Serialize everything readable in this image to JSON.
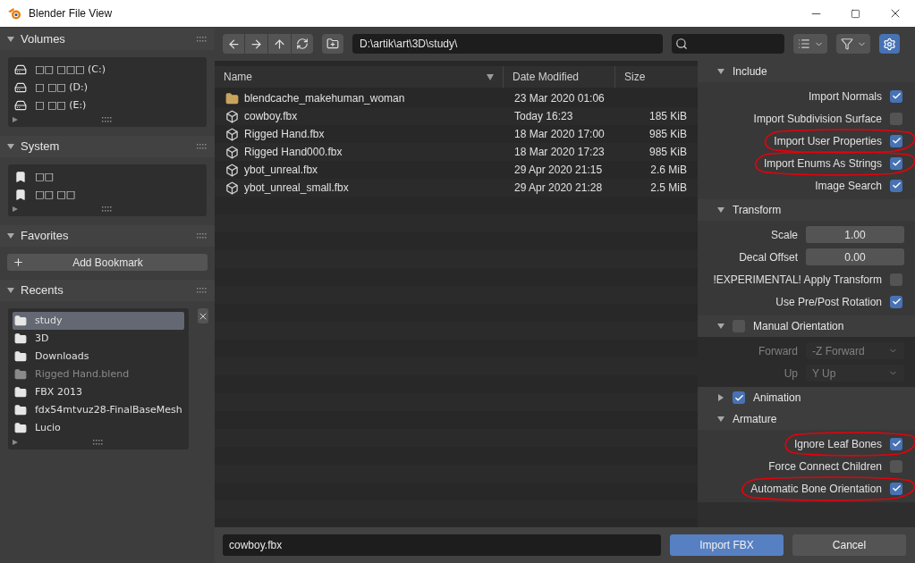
{
  "window": {
    "title": "Blender File View"
  },
  "sidebar": {
    "sections": [
      {
        "title": "Volumes",
        "expanded": true,
        "kind": "list",
        "items": [
          {
            "label": "□□ □□□ (C:)",
            "kind": "drive",
            "selected": false,
            "disabled": false
          },
          {
            "label": "□ □□ (D:)",
            "kind": "drive",
            "selected": false,
            "disabled": false
          },
          {
            "label": "□ □□ (E:)",
            "kind": "drive",
            "selected": false,
            "disabled": false
          }
        ]
      },
      {
        "title": "System",
        "expanded": true,
        "kind": "list",
        "items": [
          {
            "label": "□□",
            "kind": "bookmark",
            "selected": false,
            "disabled": false
          },
          {
            "label": "□□ □□",
            "kind": "bookmark",
            "selected": false,
            "disabled": false
          }
        ]
      },
      {
        "title": "Favorites",
        "expanded": true,
        "kind": "button",
        "button": "Add Bookmark"
      },
      {
        "title": "Recents",
        "expanded": true,
        "kind": "list",
        "clearable": true,
        "items": [
          {
            "label": "study",
            "kind": "folder",
            "selected": true,
            "disabled": false
          },
          {
            "label": "3D",
            "kind": "folder",
            "selected": false,
            "disabled": false
          },
          {
            "label": "Downloads",
            "kind": "folder",
            "selected": false,
            "disabled": false
          },
          {
            "label": "Rigged Hand.blend",
            "kind": "folder",
            "selected": false,
            "disabled": true
          },
          {
            "label": "FBX 2013",
            "kind": "folder",
            "selected": false,
            "disabled": false
          },
          {
            "label": "fdx54mtvuz28-FinalBaseMesh",
            "kind": "folder",
            "selected": false,
            "disabled": false
          },
          {
            "label": "Lucio",
            "kind": "folder",
            "selected": false,
            "disabled": false
          }
        ]
      }
    ]
  },
  "toolbar": {
    "path": "D:\\artik\\art\\3D\\study\\",
    "settings_on": true
  },
  "file_list": {
    "columns": [
      "Name",
      "Date Modified",
      "Size"
    ],
    "rows": [
      {
        "kind": "folder",
        "name": "blendcache_makehuman_woman",
        "date": "23 Mar 2020 01:06"
      },
      {
        "kind": "file",
        "name": "cowboy.fbx",
        "date": "Today 16:23",
        "size": "185 KiB"
      },
      {
        "kind": "file",
        "name": "Rigged Hand.fbx",
        "date": "18 Mar 2020 17:00",
        "size": "985 KiB"
      },
      {
        "kind": "file",
        "name": "Rigged Hand000.fbx",
        "date": "18 Mar 2020 17:23",
        "size": "985 KiB"
      },
      {
        "kind": "file",
        "name": "ybot_unreal.fbx",
        "date": "29 Apr 2020 21:15",
        "size": "2.6 MiB"
      },
      {
        "kind": "file",
        "name": "ybot_unreal_small.fbx",
        "date": "29 Apr 2020 21:28",
        "size": "2.5 MiB"
      }
    ]
  },
  "properties": {
    "panels": [
      {
        "title": "Include",
        "expanded": true,
        "rows": [
          {
            "kind": "checkbox",
            "label": "Import Normals",
            "checked": true,
            "circled": false
          },
          {
            "kind": "checkbox",
            "label": "Import Subdivision Surface",
            "checked": false,
            "circled": false
          },
          {
            "kind": "checkbox",
            "label": "Import User Properties",
            "checked": true,
            "circled": true
          },
          {
            "kind": "checkbox",
            "label": "Import Enums As Strings",
            "checked": true,
            "circled": true
          },
          {
            "kind": "checkbox",
            "label": "Image Search",
            "checked": true,
            "circled": false
          }
        ]
      },
      {
        "title": "Transform",
        "expanded": true,
        "rows": [
          {
            "kind": "number",
            "label": "Scale",
            "value": "1.00"
          },
          {
            "kind": "number",
            "label": "Decal Offset",
            "value": "0.00"
          },
          {
            "kind": "checkbox",
            "label": "!EXPERIMENTAL! Apply Transform",
            "checked": false,
            "circled": false
          },
          {
            "kind": "checkbox",
            "label": "Use Pre/Post Rotation",
            "checked": true,
            "circled": false
          }
        ]
      },
      {
        "title": "Manual Orientation",
        "expanded": true,
        "checked": false,
        "rows": [
          {
            "kind": "dropdown",
            "label": "Forward",
            "value": "-Z Forward",
            "disabled": true
          },
          {
            "kind": "dropdown",
            "label": "Up",
            "value": "Y Up",
            "disabled": true
          }
        ]
      },
      {
        "title": "Animation",
        "expanded": false,
        "checked": true
      },
      {
        "title": "Armature",
        "expanded": true,
        "rows": [
          {
            "kind": "checkbox",
            "label": "Ignore Leaf Bones",
            "checked": true,
            "circled": true
          },
          {
            "kind": "checkbox",
            "label": "Force Connect Children",
            "checked": false,
            "circled": false
          },
          {
            "kind": "checkbox",
            "label": "Automatic Bone Orientation",
            "checked": true,
            "circled": true
          }
        ]
      }
    ]
  },
  "footer": {
    "filename": "cowboy.fbx",
    "buttons": [
      {
        "label": "Import FBX",
        "primary": true
      },
      {
        "label": "Cancel",
        "primary": false
      }
    ]
  }
}
